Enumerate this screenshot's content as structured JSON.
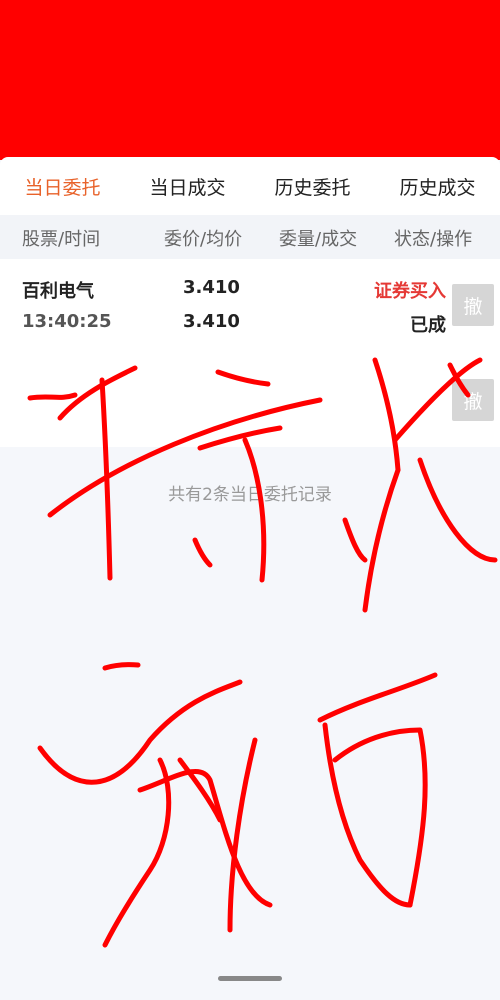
{
  "tabs": [
    {
      "label": "当日委托",
      "active": true
    },
    {
      "label": "当日成交"
    },
    {
      "label": "历史委托"
    },
    {
      "label": "历史成交"
    }
  ],
  "columns": {
    "stock_time": "股票/时间",
    "price": "委价/均价",
    "qty": "委量/成交",
    "status": "状态/操作"
  },
  "orders": [
    {
      "name": "百利电气",
      "time": "13:40:25",
      "order_price": "3.410",
      "avg_price": "3.410",
      "type": "证券买入",
      "status": "已成",
      "cancel": "撤"
    },
    {
      "cancel": "撤"
    }
  ],
  "footer": "共有2条当日委托记录",
  "colors": {
    "accent": "#e8622a",
    "buy": "#e53935",
    "redaction": "#ff0000"
  }
}
